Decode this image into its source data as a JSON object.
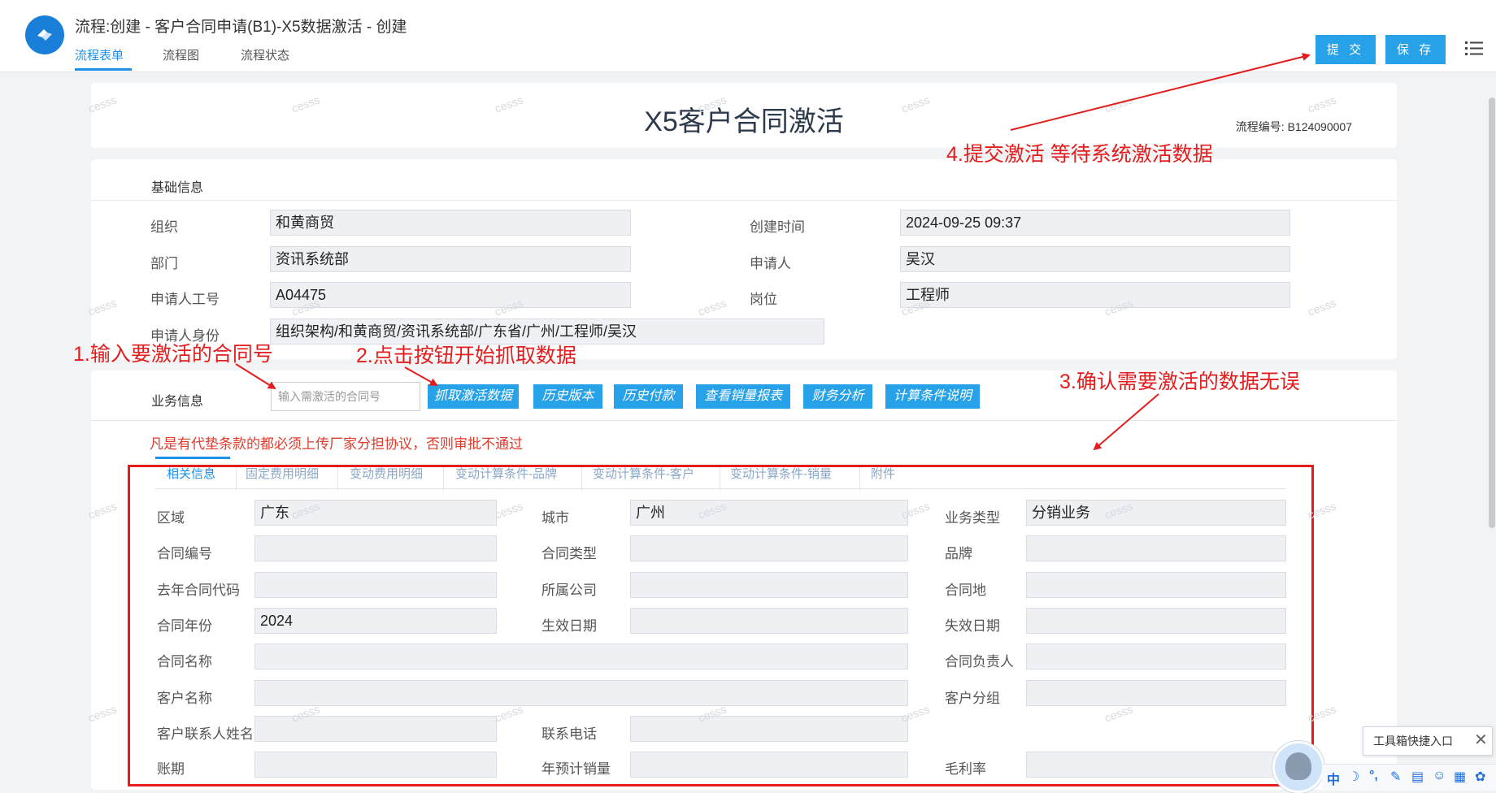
{
  "header": {
    "title": "流程:创建 - 客户合同申请(B1)-X5数据激活 - 创建",
    "tabs": [
      "流程表单",
      "流程图",
      "流程状态"
    ],
    "submit_label": "提 交",
    "save_label": "保 存"
  },
  "doc": {
    "title": "X5客户合同激活",
    "flow_no_label": "流程编号:",
    "flow_no": "B124090007"
  },
  "basic": {
    "section_title": "基础信息",
    "fields": [
      {
        "label": "组织",
        "value": "和黄商贸"
      },
      {
        "label": "创建时间",
        "value": "2024-09-25 09:37"
      },
      {
        "label": "部门",
        "value": "资讯系统部"
      },
      {
        "label": "申请人",
        "value": "吴汉"
      },
      {
        "label": "申请人工号",
        "value": "A04475"
      },
      {
        "label": "岗位",
        "value": "工程师"
      },
      {
        "label": "申请人身份",
        "value": "组织架构/和黄商贸/资讯系统部/广东省/广州/工程师/吴汉"
      }
    ]
  },
  "business": {
    "section_title": "业务信息",
    "input_placeholder": "输入需激活的合同号",
    "buttons": [
      "抓取激活数据",
      "历史版本",
      "历史付款",
      "查看销量报表",
      "财务分析",
      "计算条件说明"
    ],
    "warning": "凡是有代垫条款的都必须上传厂家分担协议，否则审批不通过",
    "tabs": [
      "相关信息",
      "固定费用明细",
      "变动费用明细",
      "变动计算条件-品牌",
      "变动计算条件-客户",
      "变动计算条件-销量",
      "附件"
    ],
    "fields": [
      {
        "label": "区域",
        "value": "广东"
      },
      {
        "label": "城市",
        "value": "广州"
      },
      {
        "label": "业务类型",
        "value": "分销业务"
      },
      {
        "label": "合同编号",
        "value": ""
      },
      {
        "label": "合同类型",
        "value": ""
      },
      {
        "label": "品牌",
        "value": ""
      },
      {
        "label": "去年合同代码",
        "value": ""
      },
      {
        "label": "所属公司",
        "value": ""
      },
      {
        "label": "合同地",
        "value": ""
      },
      {
        "label": "合同年份",
        "value": "2024"
      },
      {
        "label": "生效日期",
        "value": ""
      },
      {
        "label": "失效日期",
        "value": ""
      },
      {
        "label": "合同名称",
        "value": ""
      },
      {
        "label": "合同负责人",
        "value": ""
      },
      {
        "label": "客户名称",
        "value": ""
      },
      {
        "label": "客户分组",
        "value": ""
      },
      {
        "label": "客户联系人姓名",
        "value": ""
      },
      {
        "label": "联系电话",
        "value": ""
      },
      {
        "label": "账期",
        "value": ""
      },
      {
        "label": "年预计销量",
        "value": ""
      },
      {
        "label": "毛利率",
        "value": ""
      }
    ]
  },
  "annotations": {
    "a1": "1.输入要激活的合同号",
    "a2": "2.点击按钮开始抓取数据",
    "a3": "3.确认需要激活的数据无误",
    "a4": "4.提交激活 等待系统激活数据"
  },
  "watermark": "cesss",
  "widget": {
    "tooltip": "工具箱快捷入口",
    "toolbar_items": [
      "中",
      "☽",
      "°,",
      "✎",
      "▤",
      "☺",
      "▦",
      "✿"
    ]
  },
  "colors": {
    "accent": "#27a2e8",
    "annotation": "#e31d1d"
  }
}
